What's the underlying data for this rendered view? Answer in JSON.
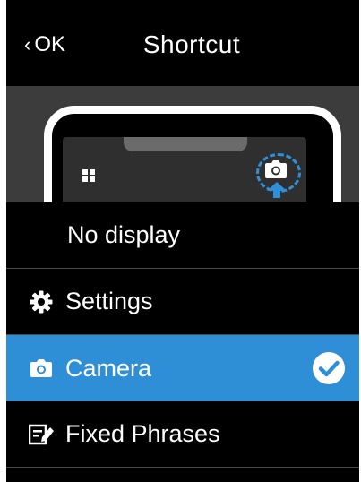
{
  "header": {
    "back_label": "OK",
    "back_chevron": "‹",
    "title": "Shortcut"
  },
  "preview": {
    "apps_icon": "apps-grid-icon",
    "shortcut_icon": "camera-icon",
    "indicator_icon": "arrow-up-icon"
  },
  "menu": {
    "items": [
      {
        "label": "No display",
        "icon": null,
        "selected": false
      },
      {
        "label": "Settings",
        "icon": "gear-icon",
        "selected": false
      },
      {
        "label": "Camera",
        "icon": "camera-icon",
        "selected": true
      },
      {
        "label": "Fixed Phrases",
        "icon": "edit-note-icon",
        "selected": false
      }
    ],
    "selected_indicator": "check-circle-icon"
  },
  "colors": {
    "background": "#000000",
    "accent": "#2e8fd6",
    "preview_bg": "#3c3c3c",
    "divider": "#4a4a4a"
  }
}
